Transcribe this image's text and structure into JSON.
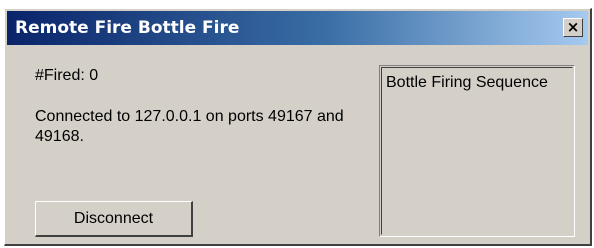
{
  "window": {
    "title": "Remote Fire Bottle Fire",
    "close_glyph": "×"
  },
  "main": {
    "fired_label": "#Fired: 0",
    "status_text": "Connected to 127.0.0.1 on ports 49167 and 49168.",
    "disconnect_label": "Disconnect"
  },
  "list": {
    "items": [
      "Bottle Firing Sequence"
    ]
  },
  "colors": {
    "titlebar_start": "#0a246a",
    "titlebar_end": "#a6caf0",
    "face": "#d4d0c8"
  }
}
